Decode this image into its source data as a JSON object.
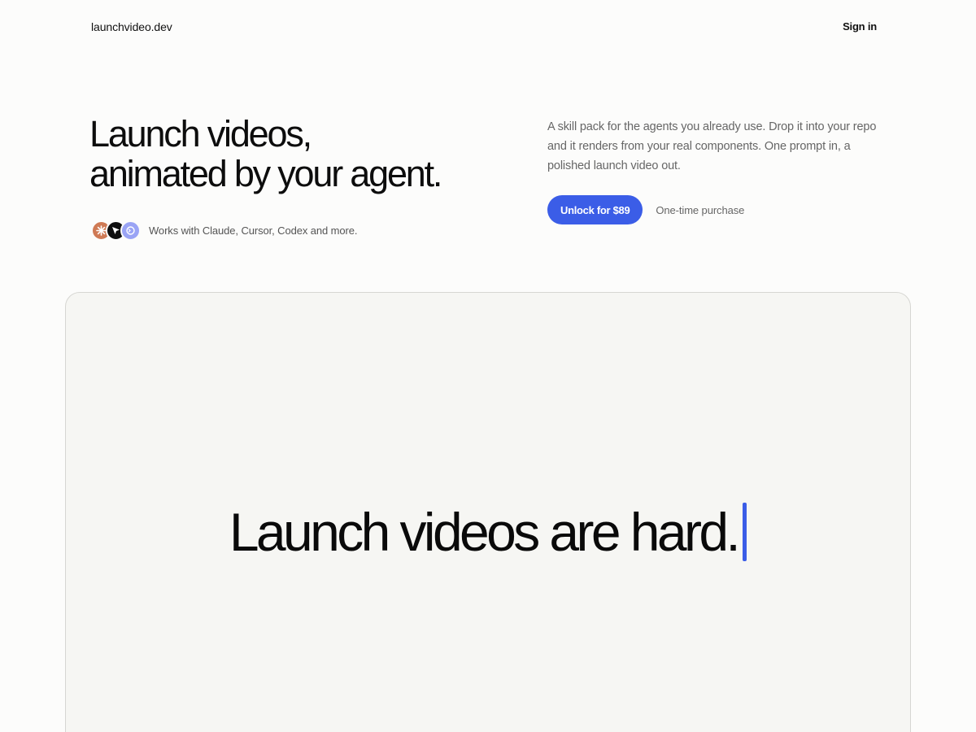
{
  "header": {
    "brand": "launchvideo.dev",
    "sign_in": "Sign in"
  },
  "hero": {
    "title_line1": "Launch videos,",
    "title_line2": "animated by your agent.",
    "works_with": "Works with Claude, Cursor, Codex and more.",
    "agent_icons": [
      "claude-icon",
      "cursor-icon",
      "codex-icon"
    ],
    "description": "A skill pack for the agents you already use. Drop it into your repo and it renders from your real components. One prompt in, a polished launch video out.",
    "cta_label": "Unlock for $89",
    "cta_note": "One-time purchase"
  },
  "video": {
    "text": "Launch videos are hard."
  },
  "colors": {
    "accent": "#3b5de7",
    "background": "#fcfcfb",
    "panel": "#f6f6f3",
    "claude": "#cf7a55",
    "cursor": "#0e0e0e",
    "codex": "#9aa4f5"
  }
}
